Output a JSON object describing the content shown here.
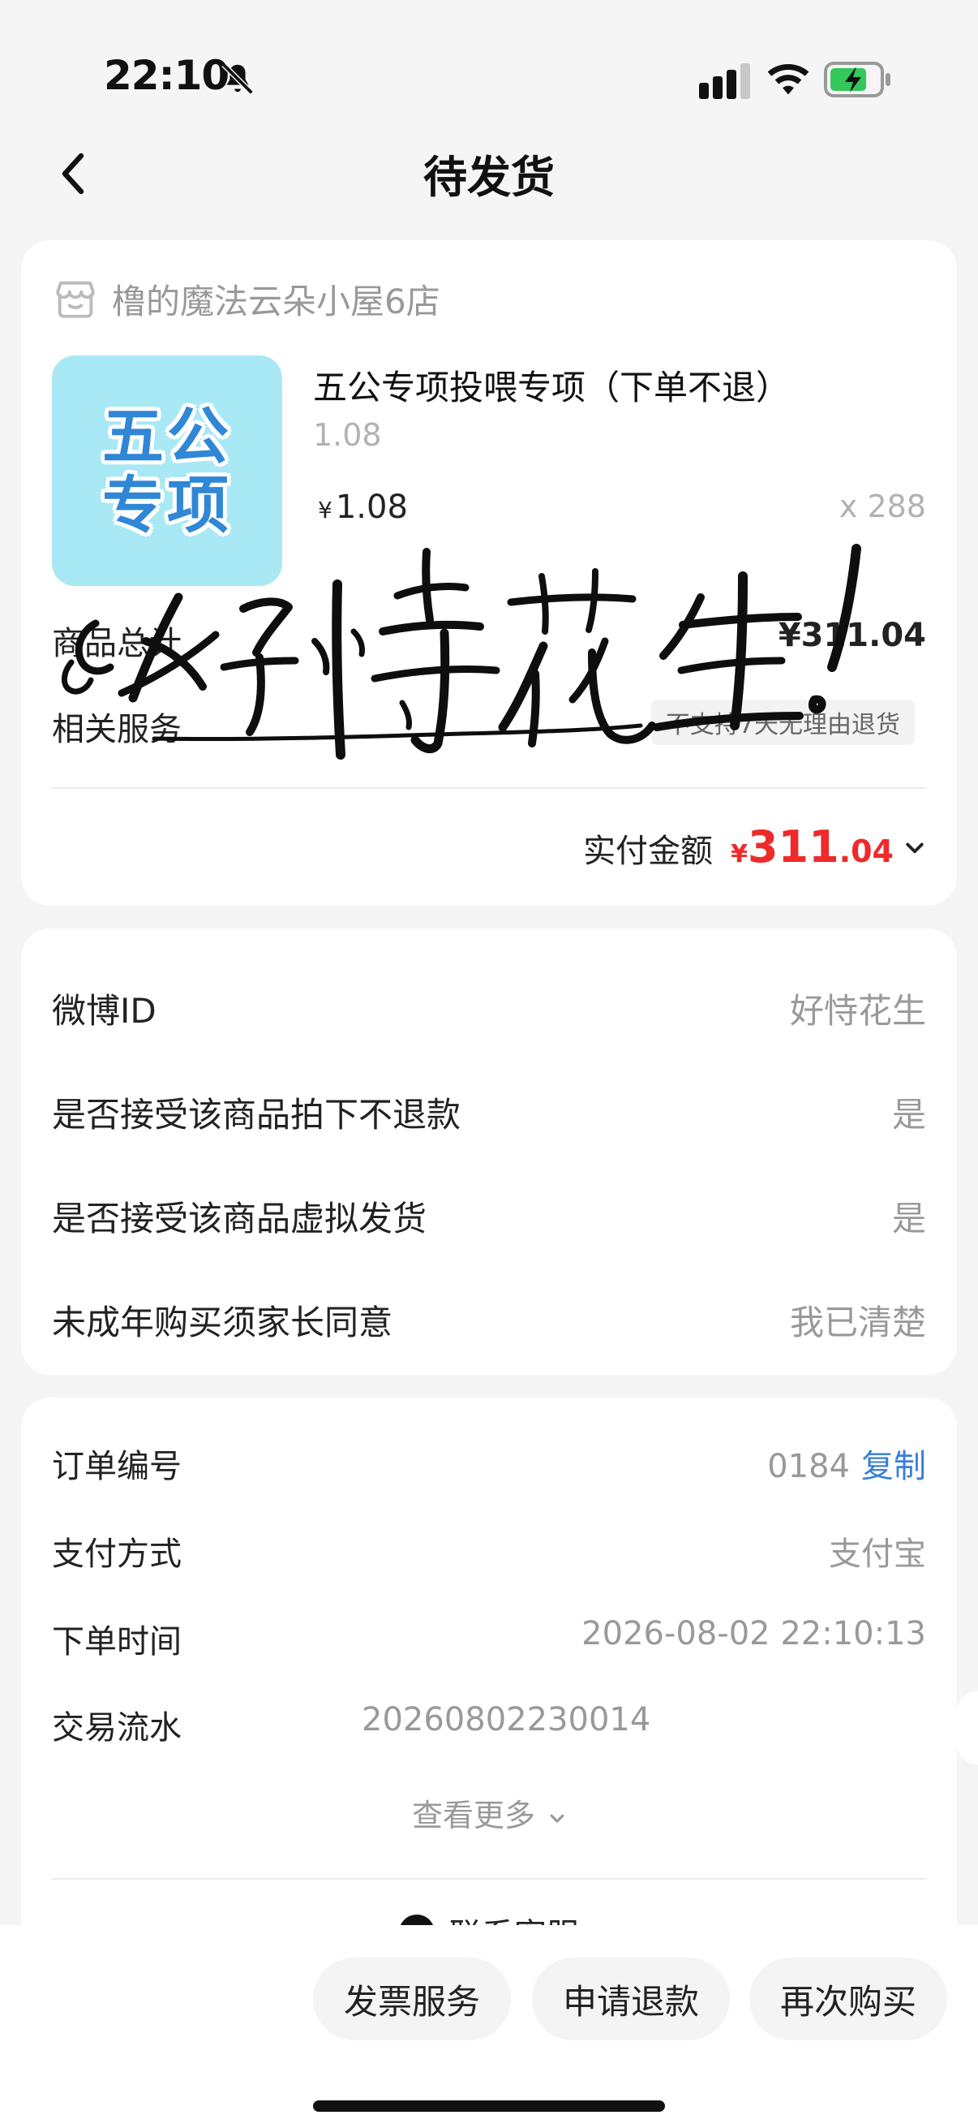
{
  "status_bar": {
    "time": "22:10"
  },
  "header": {
    "title": "待发货"
  },
  "order_card": {
    "shop_name": "橹的魔法云朵小屋6店",
    "thumb_line1": "五公",
    "thumb_line2": "专项",
    "product_title": "五公专项投喂专项（下单不退）",
    "product_spec": "1.08",
    "price_symbol": "¥",
    "price": "1.08",
    "quantity": "x 288",
    "total_label": "商品总计",
    "total_value": "¥311.04",
    "service_label": "相关服务",
    "service_tag": "不支持7天无理由退货",
    "paid_label": "实付金额",
    "paid_symbol": "¥",
    "paid_integer": "311",
    "paid_decimal": ".04"
  },
  "info_card": {
    "rows": [
      {
        "label": "微博ID",
        "value": "好恃花生"
      },
      {
        "label": "是否接受该商品拍下不退款",
        "value": "是"
      },
      {
        "label": "是否接受该商品虚拟发货",
        "value": "是"
      },
      {
        "label": "未成年购买须家长同意",
        "value": "我已清楚"
      }
    ]
  },
  "detail_card": {
    "order_no_label": "订单编号",
    "order_no_value": "0184",
    "copy_label": "复制",
    "pay_method_label": "支付方式",
    "pay_method_value": "支付宝",
    "order_time_label": "下单时间",
    "order_time_value": "2026-08-02 22:10:13",
    "txn_label": "交易流水",
    "txn_value": "20260802230014",
    "see_more_label": "查看更多",
    "contact_label": "联系客服"
  },
  "bottom_bar": {
    "invoice_label": "发票服务",
    "refund_label": "申请退款",
    "rebuy_label": "再次购买"
  },
  "overlay": {
    "signature_text": "好恃花生!"
  },
  "colors": {
    "accent_red": "#ee2a2a",
    "link_blue": "#3a7fd6",
    "thumb_bg": "#a9e8f5"
  }
}
